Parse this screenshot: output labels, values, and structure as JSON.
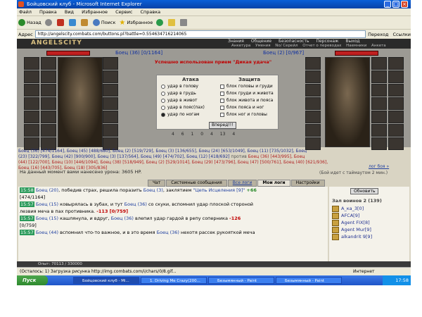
{
  "window": {
    "title": "Бойцовский клуб - Microsoft Internet Explorer"
  },
  "menu": [
    "Файл",
    "Правка",
    "Вид",
    "Избранное",
    "Сервис",
    "Справка"
  ],
  "toolbar": {
    "back": "Назад",
    "search": "Поиск",
    "favorites": "Избранное"
  },
  "address": {
    "label": "Адрес",
    "url": "http://angelscity.combats.com/buttons.pl?battle=0.554634716214065",
    "go": "Переход",
    "links": "Ссылки"
  },
  "game": {
    "logo": "ANGELSCITY",
    "nav": [
      "Знания",
      "Общение",
      "Безопасность",
      "Персонаж",
      "Выход"
    ],
    "subnav": [
      "Анкетура",
      "Умения",
      "No/ Серейл",
      "Отчет о переводах",
      "Наемники",
      "Анкета"
    ],
    "left_player": {
      "name": "Боец (36) [0/1164]"
    },
    "right_player": {
      "name": "Боец (2) [0/967]"
    },
    "message": "Успешно использован прием \"Дикая удача\"",
    "attack_title": "Атака",
    "defense_title": "Защита",
    "attacks": [
      "удар в голову",
      "удар в грудь",
      "удар в живот",
      "удар в пояс(пах)",
      "удар по ногам"
    ],
    "defenses": [
      "блок головы и груди",
      "блок груди и живота",
      "блок живота и пояса",
      "блок пояса и ног",
      "блок ног и головы"
    ],
    "go_button": "Вперед!!!",
    "stats": [
      "4",
      "6",
      "1",
      "0",
      "4",
      "13",
      "4"
    ],
    "fighters_line1": "Боец (36) [474/1164], Боец (45) [488/680], Боец (2) [519/729], Боец (3) [136/655], Боец (24) [653/1049], Боец (11) [735/1032], Боец",
    "fighters_line2": "(23) [322/799], Боец (42) [900/900], Боец (3) [137/564], Боец (49) [474/702], Боец (12) [418/692]",
    "fighters_vs": "против",
    "fighters_line2b": "Боец (36) [443/995], Боец",
    "fighters_line3": "(44) [122/700], Боец (10) [446/1094], Боец (38) [518/949], Боец (2) [529/1014], Боец (29) [473/796], Боец (47) [500/761], Боец (40) [621/936],",
    "fighters_line4": "Боец (16) [443/705], Боец (18) [305/836]",
    "damage": "На данный момент вами нанесено урона: 3605 HP.",
    "wait_label": "лог боя »",
    "wait_hint": "(Бой идет с таймаутом 2 мин.)",
    "tabs": [
      "Чат",
      "Системные сообщения",
      "Все логи",
      "Мои логи",
      "Настройки"
    ],
    "chat": [
      {
        "ts": "15:58",
        "a": "Боец (20)",
        "t": ", победив страх, решила поразить",
        "b": "Боец (3)",
        "t2": ", заклятием",
        "spell": "\"Цепь Исцеления [9]\"",
        "dmg": "+66",
        "tail": "[474/1164]"
      },
      {
        "ts": "15:57",
        "a": "Боец (15)",
        "t": " ковырялась в зубах, и тут",
        "b": "Боец (36)",
        "t2": " со скуки, вспомнил удар плоской стороной",
        "spell": "",
        "dmg": "",
        "tail": "лезвия меча в пах противника.",
        "dmg2": "-113 [0/759]"
      },
      {
        "ts": "15:57",
        "a": "Боец (15)",
        "t": " кашлянула, и вдруг,",
        "b": "Боец (36)",
        "t2": " влепил удар гардой в репу соперника",
        "spell": "",
        "dmg": "-126",
        "tail": "[0/759]"
      },
      {
        "ts": "15:57",
        "a": "Боец (44)",
        "t": " вспомнил что-то важное, и в это время",
        "b": "Боец (36)",
        "t2": " нехотя рассек рукояткой меча",
        "spell": "",
        "dmg": "",
        "tail": ""
      }
    ],
    "refresh": "Обновить",
    "zone": "Зал воинов 2 (139)",
    "players": [
      "А_ка_3[0]",
      "AFCA[9]",
      "Agent FIX[8]",
      "Agent Mur[9]",
      "alkandrit 9[9]"
    ],
    "footer_chat": "Опыт: 70113 / 330000"
  },
  "statusbar": {
    "text": "(Осталось: 1) Загрузка рисунка http://img.combats.com/i/chars/0/8.gif...",
    "zone": "Интернет"
  },
  "taskbar": {
    "start": "Пуск",
    "tasks": [
      "Бойцовский клуб - Mi...",
      "1. Driving Me Crazy(200...",
      "Безымянный - Paint",
      "Безымянный - Paint"
    ],
    "clock": "17:58"
  }
}
